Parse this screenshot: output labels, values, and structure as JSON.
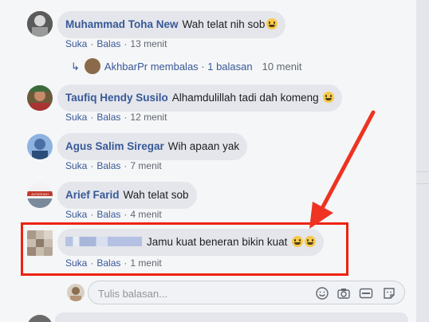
{
  "comments": [
    {
      "author": "Muhammad Toha New",
      "text": "Wah telat nih sob",
      "emoji": "grin-icon",
      "like": "Suka",
      "reply": "Balas",
      "time": "13 menit"
    },
    {
      "author": "Taufiq Hendy Susilo",
      "text": "Alhamdulillah tadi dah komeng",
      "emoji": "grin-icon",
      "like": "Suka",
      "reply": "Balas",
      "time": "12 menit"
    },
    {
      "author": "Agus Salim Siregar",
      "text": "Wih apaan yak",
      "like": "Suka",
      "reply": "Balas",
      "time": "7 menit"
    },
    {
      "author": "Arief Farid",
      "text": "Wah telat sob",
      "like": "Suka",
      "reply": "Balas",
      "time": "4 menit"
    },
    {
      "author": "",
      "text": "Jamu kuat beneran bikin kuat",
      "emoji": "grinning-icon",
      "like": "Suka",
      "reply": "Balas",
      "time": "1 menit"
    }
  ],
  "reply_thread": {
    "text": "AkhbarPr membalas · 1 balasan",
    "time": "10 menit"
  },
  "avatar_badge": "ALFATIHAH",
  "reply_input": {
    "placeholder": "Tulis balasan..."
  },
  "reply_tools": [
    "emoji-icon",
    "camera-icon",
    "gif-icon",
    "sticker-icon"
  ],
  "colors": {
    "link": "#385898",
    "highlight": "#ee2211",
    "arrow": "#ee3322",
    "bubble": "#e4e6eb"
  }
}
